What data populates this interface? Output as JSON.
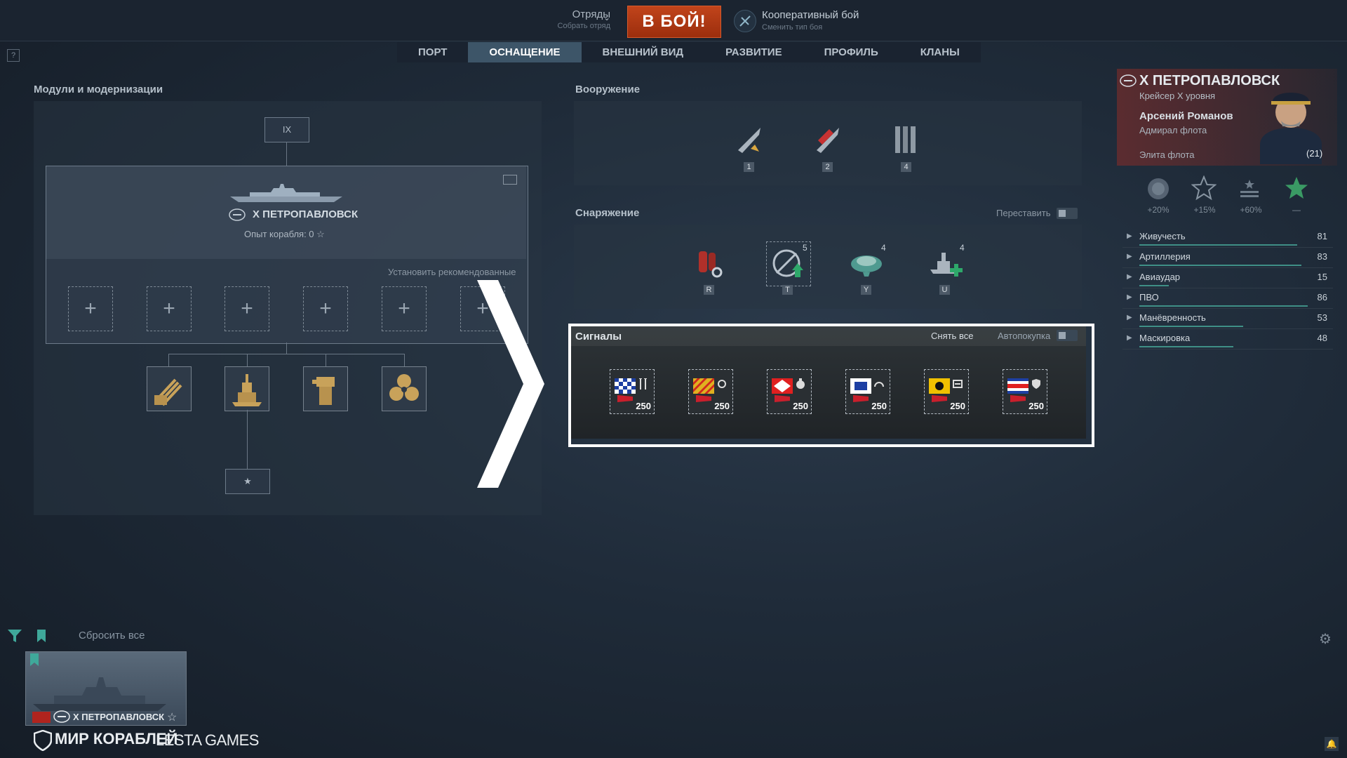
{
  "topbar": {
    "squads_label": "Отряды",
    "squads_sub": "Собрать отряд",
    "battle_button": "В БОЙ!",
    "mode_label": "Кооперативный бой",
    "mode_sub": "Сменить тип боя"
  },
  "help_label": "?",
  "nav": {
    "tabs": [
      "ПОРТ",
      "ОСНАЩЕНИЕ",
      "ВНЕШНИЙ ВИД",
      "РАЗВИТИЕ",
      "ПРОФИЛЬ",
      "КЛАНЫ"
    ],
    "active": "ОСНАЩЕНИЕ"
  },
  "modules": {
    "title": "Модули и модернизации",
    "tier_node": "IX",
    "ship_name": "X ПЕТРОПАВЛОВСК",
    "ship_xp": "Опыт корабля:  0 ☆",
    "recommended": "Установить рекомендованные",
    "slot_symbol": "+",
    "module_icons": [
      "main-battery-icon",
      "hull-icon",
      "fire-control-icon",
      "propulsion-icon"
    ],
    "bottom_node": "★"
  },
  "armament": {
    "title": "Вооружение",
    "items": [
      {
        "icon": "he-shell-icon",
        "key": "1"
      },
      {
        "icon": "ap-shell-icon",
        "key": "2"
      },
      {
        "icon": "torpedo-icon",
        "key": "4"
      }
    ]
  },
  "equipment": {
    "title": "Снаряжение",
    "swap_label": "Переставить",
    "items": [
      {
        "icon": "damage-control-icon",
        "key": "R",
        "count": ""
      },
      {
        "icon": "spotting-aircraft-icon",
        "key": "T",
        "count": "5"
      },
      {
        "icon": "hydroacoustic-icon",
        "key": "Y",
        "count": "4"
      },
      {
        "icon": "repair-party-icon",
        "key": "U",
        "count": "4"
      }
    ]
  },
  "signals": {
    "title": "Сигналы",
    "remove_all": "Снять все",
    "autobuy": "Автопокупка",
    "items": [
      {
        "icon": "signal-1-icon",
        "count": "250",
        "flag_color": "#1d3fa3",
        "sym": "#dcdcdc"
      },
      {
        "icon": "signal-2-icon",
        "count": "250",
        "flag_color": "#e0b020",
        "sym": "#dcdcdc"
      },
      {
        "icon": "signal-3-icon",
        "count": "250",
        "flag_color": "#e02020",
        "sym": "#dcdcdc"
      },
      {
        "icon": "signal-4-icon",
        "count": "250",
        "flag_color": "#1d3fa3",
        "sym": "#dcdcdc"
      },
      {
        "icon": "signal-5-icon",
        "count": "250",
        "flag_color": "#f0c000",
        "sym": "#dcdcdc"
      },
      {
        "icon": "signal-6-icon",
        "count": "250",
        "flag_color": "#1d3fa3",
        "sym": "#dcdcdc"
      }
    ]
  },
  "commander": {
    "ship_name": "X ПЕТРОПАВЛОВСК",
    "ship_sub": "Крейсер X уровня",
    "name": "Арсений Романов",
    "rank": "Адмирал флота",
    "elite": "Элита флота",
    "level": "21",
    "bonuses": [
      "+20%",
      "+15%",
      "+60%",
      "—"
    ],
    "stats": [
      {
        "name": "Живучесть",
        "value": "81"
      },
      {
        "name": "Артиллерия",
        "value": "83"
      },
      {
        "name": "Авиаудар",
        "value": "15"
      },
      {
        "name": "ПВО",
        "value": "86"
      },
      {
        "name": "Манёвренность",
        "value": "53"
      },
      {
        "name": "Маскировка",
        "value": "48"
      }
    ]
  },
  "bottom": {
    "reset_all": "Сбросить все",
    "thumb_name": "X ПЕТРОПАВЛОВСК",
    "brand": "МИР КОРАБЛЕЙ",
    "lesta": "LESTA GAMES"
  },
  "colors": {
    "accent_battle": "#b93a16",
    "tab_active": "#3d5568",
    "stat_bar": "#3f8f86"
  }
}
